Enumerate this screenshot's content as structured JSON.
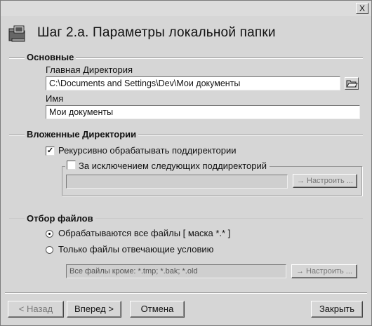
{
  "window": {
    "close_label": "X"
  },
  "header": {
    "title": "Шаг 2.а. Параметры локальной папки",
    "icon": "computer-folder-icon"
  },
  "basic": {
    "section_title": "Основные",
    "main_dir_label": "Главная Директория",
    "main_dir_value": "C:\\Documents and Settings\\Dev\\Мои документы",
    "name_label": "Имя",
    "name_value": "Мои документы"
  },
  "subdirs": {
    "section_title": "Вложенные Директории",
    "recursive_label": "Рекурсивно обрабатывать поддиректории",
    "recursive_checked": true,
    "except_label": "За исключением следующих поддиректорий",
    "except_checked": false,
    "configure_label": "Настроить ..."
  },
  "files": {
    "section_title": "Отбор файлов",
    "all_files_label": "Обрабатываются все файлы [ маска *.* ]",
    "only_matching_label": "Только файлы отвечающие условию",
    "filter_value": "Все файлы кроме: *.tmp; *.bak; *.old",
    "configure_label": "Настроить ...",
    "selected": "all"
  },
  "footer": {
    "back_label": "< Назад",
    "next_label": "Вперед >",
    "cancel_label": "Отмена",
    "close_label": "Закрыть"
  }
}
